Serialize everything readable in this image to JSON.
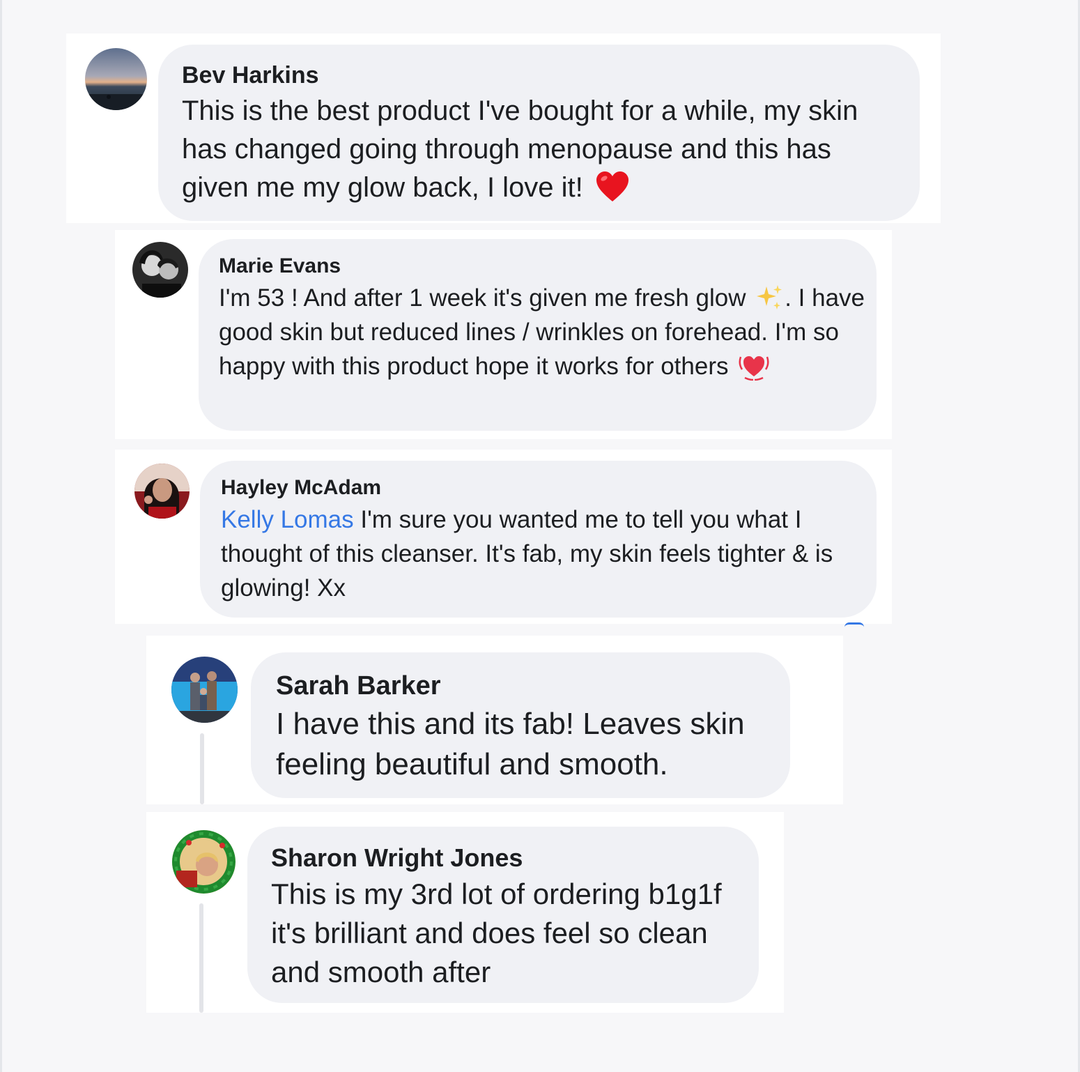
{
  "comments": [
    {
      "name": "Bev Harkins",
      "avatar": "sunset-beach-avatar",
      "text": "This is the best product I've bought for a while, my skin has changed going through menopause and this has given me my glow back, I love it!",
      "emoji": "red-heart-icon"
    },
    {
      "name": "Marie Evans",
      "avatar": "black-white-couple-avatar",
      "text_before": "I'm 53 ! And after 1 week it's given me fresh glow",
      "text_after": ". I have good skin but reduced lines / wrinkles on forehead. I'm so happy with this product hope it works for others",
      "emoji_1": "sparkles-icon",
      "emoji_2": "beating-heart-icon"
    },
    {
      "name": "Hayley McAdam",
      "avatar": "woman-selfie-avatar",
      "mention": "Kelly Lomas",
      "text": " I'm sure you wanted me to tell you what I thought of this cleanser. It's fab, my skin feels tighter & is glowing! Xx"
    },
    {
      "name": "Sarah Barker",
      "avatar": "family-group-avatar",
      "text": "I have this and its fab! Leaves skin feeling beautiful and smooth."
    },
    {
      "name": "Sharon Wright Jones",
      "avatar": "christmas-wreath-avatar",
      "text": "This is my 3rd lot of ordering b1g1f it's brilliant and does feel so clean and smooth after"
    }
  ],
  "colors": {
    "bubble": "#f0f1f5",
    "mention": "#3578e5",
    "text": "#1c1e21"
  }
}
